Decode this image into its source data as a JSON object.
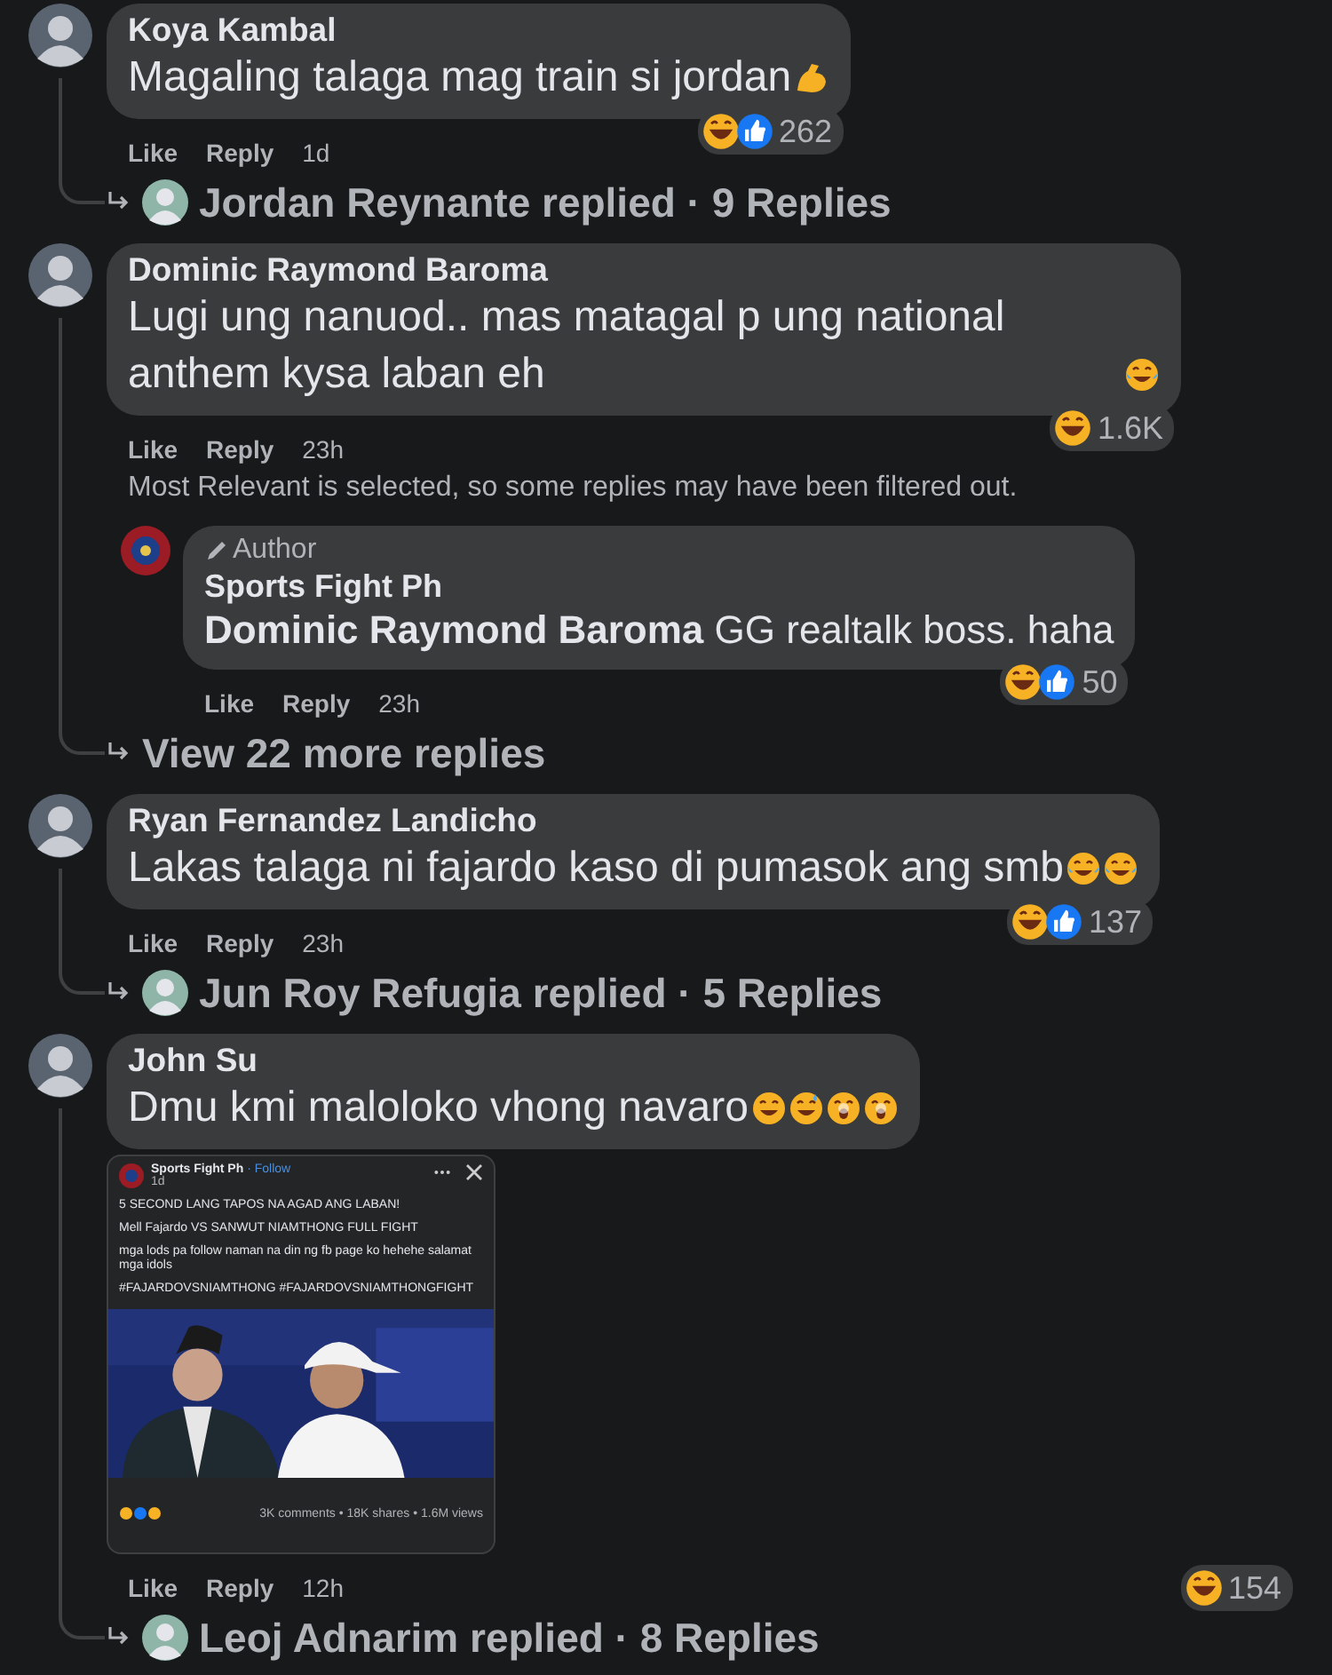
{
  "comments": [
    {
      "author": "Koya Kambal",
      "text": "Magaling talaga mag train si jordan",
      "text_emojis": [
        {
          "kind": "flex"
        }
      ],
      "actions": [
        "Like",
        "Reply"
      ],
      "time": "1d",
      "reactions": {
        "icons": [
          {
            "kind": "haha"
          },
          {
            "kind": "like"
          }
        ],
        "count": "262"
      },
      "replies_link": {
        "kind": "replied",
        "text": "Jordan Reynante replied · 9 Replies"
      }
    },
    {
      "author": "Dominic Raymond Baroma",
      "text": "Lugi ung nanuod.. mas matagal p ung national anthem kysa laban eh",
      "text_emojis": [
        {
          "kind": "laugh"
        }
      ],
      "actions": [
        "Like",
        "Reply"
      ],
      "time": "23h",
      "reactions": {
        "icons": [
          {
            "kind": "haha"
          }
        ],
        "count": "1.6K"
      },
      "notice": "Most Relevant is selected, so some replies may have been filtered out.",
      "replies": [
        {
          "badge": "Author",
          "author": "Sports Fight Ph",
          "text": "**Dominic Raymond Baroma** GG realtalk boss. haha",
          "actions": [
            "Like",
            "Reply"
          ],
          "time": "23h",
          "reactions": {
            "icons": [
              {
                "kind": "haha"
              },
              {
                "kind": "like"
              }
            ],
            "count": "50"
          }
        }
      ],
      "replies_link": {
        "kind": "more",
        "text": "View 22 more replies"
      }
    },
    {
      "author": "Ryan Fernandez Landicho",
      "text": "Lakas talaga ni fajardo kaso di pumasok ang smb",
      "text_emojis": [
        {
          "kind": "laugh"
        },
        {
          "kind": "laugh"
        }
      ],
      "actions": [
        "Like",
        "Reply"
      ],
      "time": "23h",
      "reactions": {
        "icons": [
          {
            "kind": "haha"
          },
          {
            "kind": "like"
          }
        ],
        "count": "137"
      },
      "replies_link": {
        "kind": "replied",
        "text": "Jun Roy Refugia replied · 5 Replies"
      }
    },
    {
      "author": "John Su",
      "text": "Dmu kmi maloloko vhong navaro",
      "text_emojis": [
        {
          "kind": "grin"
        },
        {
          "kind": "sweat"
        },
        {
          "kind": "shock"
        },
        {
          "kind": "shock"
        }
      ],
      "attachment": {
        "page": "Sports Fight Ph",
        "follow": "· Follow",
        "time": "1d",
        "lines": [
          "5 SECOND LANG TAPOS NA AGAD ANG LABAN!",
          "Mell Fajardo VS SANWUT NIAMTHONG FULL FIGHT",
          "mga lods pa follow naman na din ng fb page ko hehehe salamat mga idols",
          "#FAJARDOVSNIAMTHONG #FAJARDOVSNIAMTHONGFIGHT"
        ],
        "stats": "3K comments • 18K shares • 1.6M views"
      },
      "actions": [
        "Like",
        "Reply"
      ],
      "time": "12h",
      "reactions": {
        "icons": [
          {
            "kind": "haha"
          }
        ],
        "count": "154"
      },
      "replies_link": {
        "kind": "replied",
        "text": "Leoj Adnarim replied · 8 Replies"
      }
    }
  ]
}
